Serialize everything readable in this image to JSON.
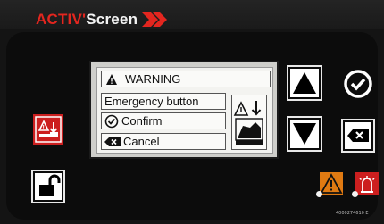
{
  "header": {
    "brand_part1": "ACTIV'",
    "brand_part2": "Screen",
    "brand_color": "#e3261f"
  },
  "display": {
    "title": "WARNING",
    "message": "Emergency button",
    "confirm_label": "Confirm",
    "cancel_label": "Cancel",
    "status_icon": "emergency-stop-icon"
  },
  "icons": {
    "up": "arrow-up-icon",
    "down": "arrow-down-icon",
    "confirm": "checkmark-circle-icon",
    "cancel": "backspace-icon",
    "side": "emergency-stop-icon",
    "lock": "unlock-icon",
    "warn": "warning-icon",
    "alarm": "alarm-icon"
  },
  "colors": {
    "warning": "#e07a12",
    "alarm": "#cc1f1f"
  },
  "serial_code": "4000274610 E"
}
